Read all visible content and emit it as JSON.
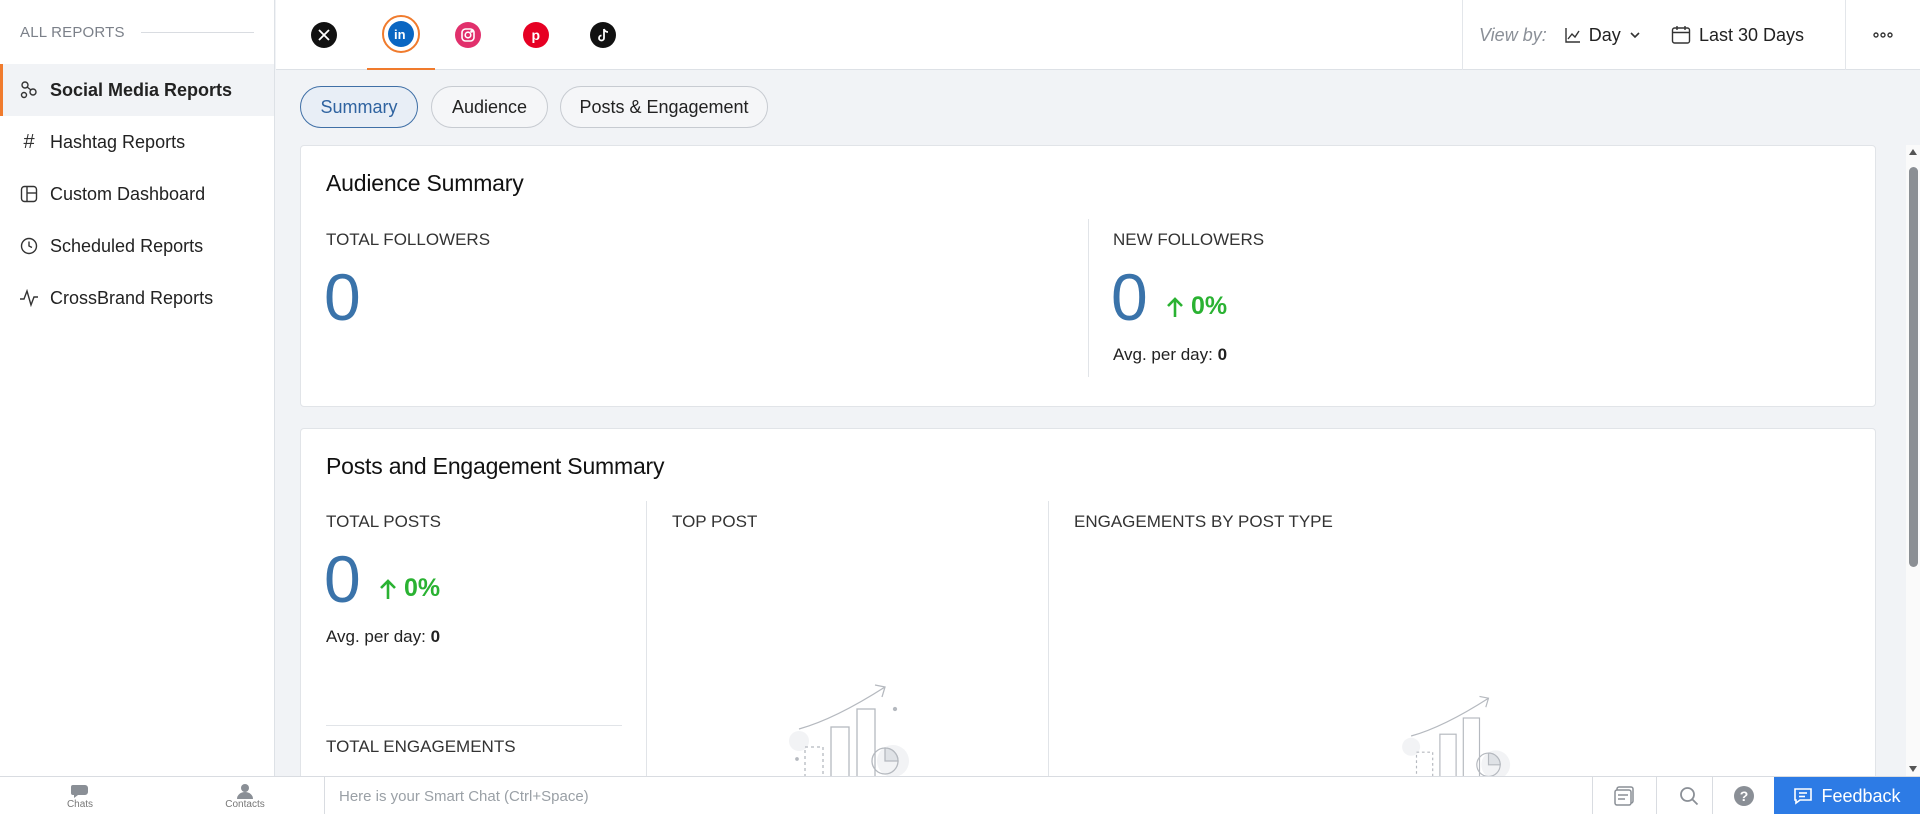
{
  "sidebar": {
    "header": "ALL REPORTS",
    "items": [
      {
        "label": "Social Media Reports",
        "icon": "social-icon"
      },
      {
        "label": "Hashtag Reports",
        "icon": "hashtag-icon"
      },
      {
        "label": "Custom Dashboard",
        "icon": "dashboard-icon"
      },
      {
        "label": "Scheduled Reports",
        "icon": "clock-icon"
      },
      {
        "label": "CrossBrand Reports",
        "icon": "pulse-icon"
      }
    ]
  },
  "networks": [
    "x",
    "linkedin",
    "instagram",
    "pinterest",
    "tiktok"
  ],
  "selected_network": "linkedin",
  "topbar": {
    "view_by_label": "View by:",
    "view_by_value": "Day",
    "date_range": "Last 30 Days"
  },
  "tabs": [
    "Summary",
    "Audience",
    "Posts & Engagement"
  ],
  "audience": {
    "title": "Audience Summary",
    "total_followers_label": "TOTAL FOLLOWERS",
    "total_followers_value": "0",
    "new_followers_label": "NEW FOLLOWERS",
    "new_followers_value": "0",
    "new_followers_change": "0%",
    "avg_label": "Avg. per day:",
    "avg_value": "0"
  },
  "posts": {
    "title": "Posts and Engagement Summary",
    "total_posts_label": "TOTAL POSTS",
    "total_posts_value": "0",
    "total_posts_change": "0%",
    "avg_label": "Avg. per day:",
    "avg_value": "0",
    "total_engagements_label": "TOTAL ENGAGEMENTS",
    "top_post_label": "TOP POST",
    "engagements_by_type_label": "ENGAGEMENTS BY POST TYPE"
  },
  "bottombar": {
    "chats": "Chats",
    "contacts": "Contacts",
    "smart_chat_placeholder": "Here is your Smart Chat (Ctrl+Space)",
    "feedback": "Feedback"
  },
  "colors": {
    "accent": "#f07b2d",
    "metric": "#3a73aa",
    "positive": "#2ab232",
    "feedback": "#2d7be5"
  }
}
